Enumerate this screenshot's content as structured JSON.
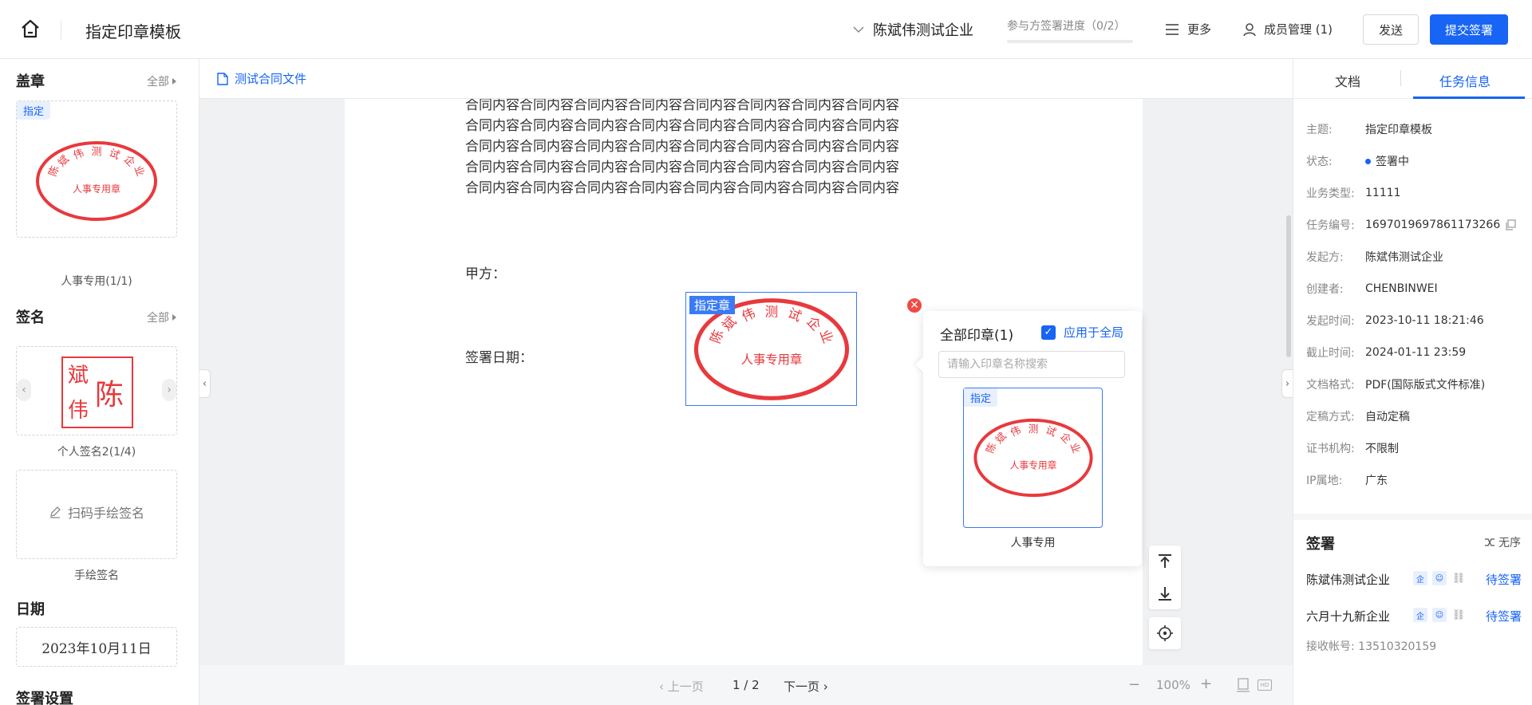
{
  "header": {
    "title": "指定印章模板",
    "company": "陈斌伟测试企业",
    "progress_label": "参与方签署进度（0/2）",
    "progress_fraction": 0.0,
    "more": "更多",
    "members": "成员管理 (1)",
    "send": "发送",
    "submit": "提交签署"
  },
  "left": {
    "seal_section": "盖章",
    "all": "全部",
    "seal_tag": "指定",
    "seal_caption": "人事专用(1/1)",
    "sign_section": "签名",
    "personal_sign_caption": "个人签名2(1/4)",
    "personal_sign_chars": [
      "斌",
      "陈",
      "伟"
    ],
    "handdraw_label": "扫码手绘签名",
    "handdraw_caption": "手绘签名",
    "date_section": "日期",
    "date_value": "2023年10月11日",
    "settings_section": "签署设置"
  },
  "seal_art": {
    "arc_chars": [
      "陈",
      "斌",
      "伟",
      "测",
      "试",
      "企",
      "业"
    ],
    "center_text": "人事专用章",
    "color": "#e8393d"
  },
  "document": {
    "file_tab": "测试合同文件",
    "content_line": "合同内容合同内容合同内容合同内容合同内容合同内容合同内容合同内容",
    "party_a": "甲方：",
    "sign_date": "签署日期：",
    "placed_tag": "指定章"
  },
  "popover": {
    "title": "全部印章(1)",
    "apply_all": "应用于全局",
    "search_placeholder": "请输入印章名称搜索",
    "card_tag": "指定",
    "card_caption": "人事专用"
  },
  "pager": {
    "prev": "上一页",
    "page": "1 / 2",
    "next": "下一页",
    "zoom": "100%"
  },
  "right": {
    "tab_doc": "文档",
    "tab_task": "任务信息",
    "info": [
      {
        "k": "主题:",
        "v": "指定印章模板"
      },
      {
        "k": "状态:",
        "v": "签署中"
      },
      {
        "k": "业务类型:",
        "v": "11111"
      },
      {
        "k": "任务编号:",
        "v": "1697019697861173266"
      },
      {
        "k": "发起方:",
        "v": "陈斌伟测试企业"
      },
      {
        "k": "创建者:",
        "v": "CHENBINWEI"
      },
      {
        "k": "发起时间:",
        "v": "2023-10-11 18:21:46"
      },
      {
        "k": "截止时间:",
        "v": "2024-01-11 23:59"
      },
      {
        "k": "文档格式:",
        "v": "PDF(国际版式文件标准)"
      },
      {
        "k": "定稿方式:",
        "v": "自动定稿"
      },
      {
        "k": "证书机构:",
        "v": "不限制"
      },
      {
        "k": "IP属地:",
        "v": "广东"
      }
    ],
    "sign_title": "签署",
    "order": "无序",
    "signers": [
      {
        "name": "陈斌伟测试企业",
        "status": "待签署"
      },
      {
        "name": "六月十九新企业",
        "status": "待签署"
      }
    ],
    "receive_label": "接收帐号:",
    "receive_value": "13510320159"
  },
  "colors": {
    "accent": "#1764f5",
    "seal": "#e8393d",
    "danger": "#f04a45"
  }
}
